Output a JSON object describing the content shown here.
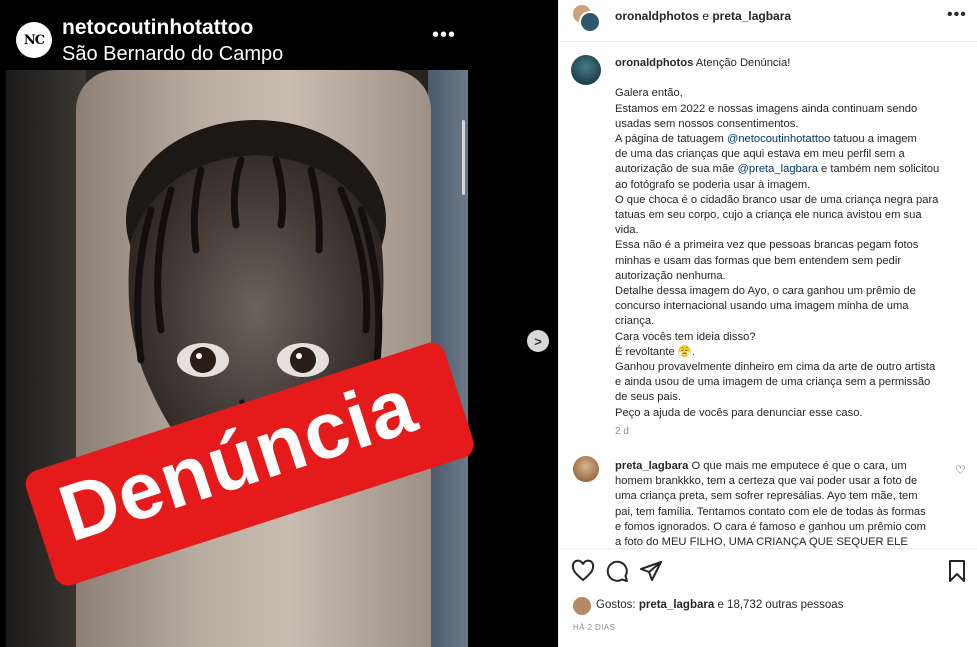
{
  "media": {
    "username": "netocoutinhotattoo",
    "location": "São Bernardo do Campo",
    "avatar_text": "NC",
    "more_icon": "ellipsis-horizontal",
    "banner_text": "Denúncia",
    "next_icon": "chevron-right"
  },
  "post": {
    "header": {
      "user1": "oronaldphotos",
      "conj": " e ",
      "user2": "preta_lagbara",
      "more_icon": "ellipsis-horizontal"
    },
    "caption": {
      "username": "oronaldphotos",
      "title": " Atenção Denúncia!",
      "lines": [
        "Galera então,",
        "Estamos em 2022 e nossas imagens ainda continuam sendo",
        "usadas sem nossos consentimentos.",
        "A página de tatuagem @netocoutinhotattoo tatuou a imagem",
        "de uma das crianças que aqui estava em meu perfil sem a",
        "autorização de sua mãe @preta_lagbara e também nem solicitou",
        "ao fotógrafo se poderia usar à imagem.",
        "O que choca é o cidadão branco usar de uma criança negra para",
        "tatuas em seu corpo, cujo a criança ele nunca avistou em sua",
        "vida.",
        "Essa não é a primeira vez que pessoas brancas pegam fotos",
        "minhas e usam das formas que bem entendem sem pedir",
        "autorização nenhuma.",
        "Detalhe dessa imagem do Ayo, o cara ganhou um prêmio de",
        "concurso internacional usando uma imagem minha de uma",
        "criança.",
        "Cara vocês tem ideia disso?",
        "É revoltante 😤.",
        "Ganhou provavelmente dinheiro em cima da arte de outro artista",
        "e ainda usou de uma imagem de uma criança sem a permissão",
        "de seus pais.",
        "Peço a ajuda de vocês para denunciar esse caso."
      ],
      "time": "2 d"
    },
    "comment": {
      "username": "preta_lagbara",
      "lines": [
        " O que mais me emputece é que o cara, um",
        "homem brankkko, tem a certeza que vai poder usar a foto de",
        "uma criança preta, sem sofrer represálias. Ayo tem mãe, tem",
        "pai, tem família. Tentamos contato com ele de todas às formas",
        "e fomos ignorados. O cara é famoso e ganhou um prêmio com",
        "a foto do MEU FILHO, UMA CRIANÇA QUE SEQUER ELE"
      ],
      "heart_icon": "heart-outline"
    },
    "actions": {
      "like_icon": "heart-outline",
      "comment_icon": "speech-bubble",
      "share_icon": "paper-plane",
      "save_icon": "bookmark"
    },
    "likes": {
      "prefix": "Gostos: ",
      "user": "preta_lagbara",
      "suffix": " e 18,732 outras pessoas"
    },
    "posted": "HÁ 2 DIAS"
  },
  "colors": {
    "banner": "#e51b1b",
    "link": "#00376b",
    "muted": "#8e8e8e"
  }
}
